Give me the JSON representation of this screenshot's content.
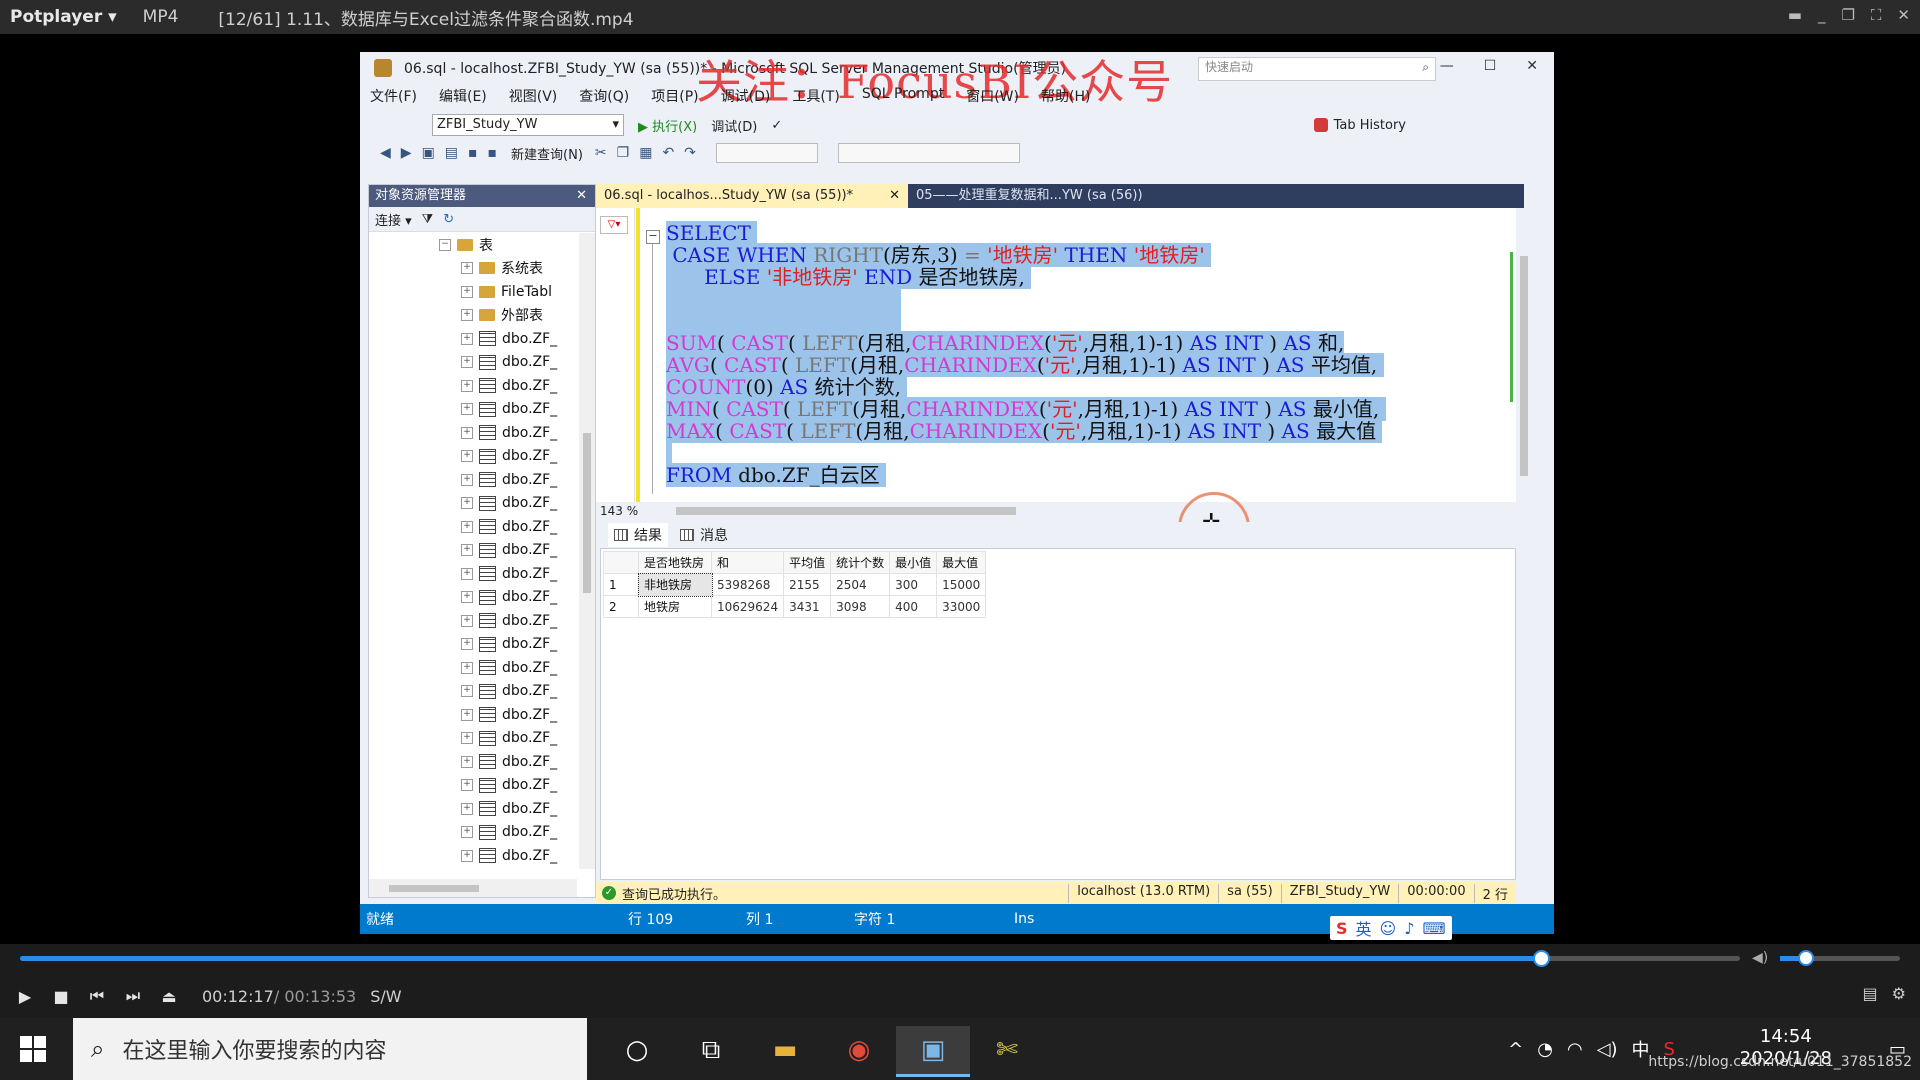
{
  "player": {
    "brand": "Potplayer ▾",
    "format": "MP4",
    "file": "[12/61] 1.11、数据库与Excel过滤条件聚合函数.mp4",
    "time_current": "00:12:17",
    "time_total": "/ 00:13:53",
    "mode": "S/W",
    "progress": 0.884,
    "volume": 0.2
  },
  "watermark": "关注：FocusBI公众号",
  "ssms": {
    "title": "06.sql - localhost.ZFBI_Study_YW (sa (55))* - Microsoft SQL Server Management Studio(管理员)",
    "quick_launch": "快速启动",
    "menu": [
      "文件(F)",
      "编辑(E)",
      "视图(V)",
      "查询(Q)",
      "项目(P)",
      "调试(D)",
      "工具(T)",
      "SQL Prompt",
      "窗口(W)",
      "帮助(H)"
    ],
    "db_selected": "ZFBI_Study_YW",
    "execute": "▶ 执行(X)",
    "debug": "调试(D)",
    "tab_history": "Tab History",
    "new_query": "新建查询(N)",
    "object_explorer": {
      "title": "对象资源管理器",
      "connect": "连接 ▾",
      "root": "表",
      "folders": [
        "系统表",
        "FileTabl",
        "外部表"
      ],
      "tables": [
        "dbo.ZF_",
        "dbo.ZF_",
        "dbo.ZF_",
        "dbo.ZF_",
        "dbo.ZF_",
        "dbo.ZF_",
        "dbo.ZF_",
        "dbo.ZF_",
        "dbo.ZF_",
        "dbo.ZF_",
        "dbo.ZF_",
        "dbo.ZF_",
        "dbo.ZF_",
        "dbo.ZF_",
        "dbo.ZF_",
        "dbo.ZF_",
        "dbo.ZF_",
        "dbo.ZF_",
        "dbo.ZF_",
        "dbo.ZF_",
        "dbo.ZF_",
        "dbo.ZF_",
        "dbo.ZF_"
      ]
    },
    "tabs": [
      "06.sql - localhos...Study_YW (sa (55))*",
      "05——处理重复数据和...YW (sa (56))"
    ],
    "zoom": "143 %",
    "results_tab": "结果",
    "messages_tab": "消息",
    "columns": [
      "",
      "是否地铁房",
      "和",
      "平均值",
      "统计个数",
      "最小值",
      "最大值"
    ],
    "rows": [
      [
        "1",
        "非地铁房",
        "5398268",
        "2155",
        "2504",
        "300",
        "15000"
      ],
      [
        "2",
        "地铁房",
        "10629624",
        "3431",
        "3098",
        "400",
        "33000"
      ]
    ],
    "query_status": "查询已成功执行。",
    "server": "localhost (13.0 RTM)",
    "user": "sa (55)",
    "database": "ZFBI_Study_YW",
    "elapsed": "00:00:00",
    "row_count": "2 行",
    "status_ready": "就绪",
    "status_line": "行 109",
    "status_col": "列 1",
    "status_char": "字符 1",
    "status_ins": "Ins"
  },
  "taskbar": {
    "search_placeholder": "在这里输入你要搜索的内容",
    "ime": "中",
    "time": "14:54",
    "date": "2020/1/28",
    "url": "https://blog.csdn.net/u011_37851852"
  },
  "colors": {
    "accent": "#007acc",
    "tab_active": "#fff1b7",
    "highlight": "#9cc3ea",
    "watermark": "#e52b2b"
  }
}
